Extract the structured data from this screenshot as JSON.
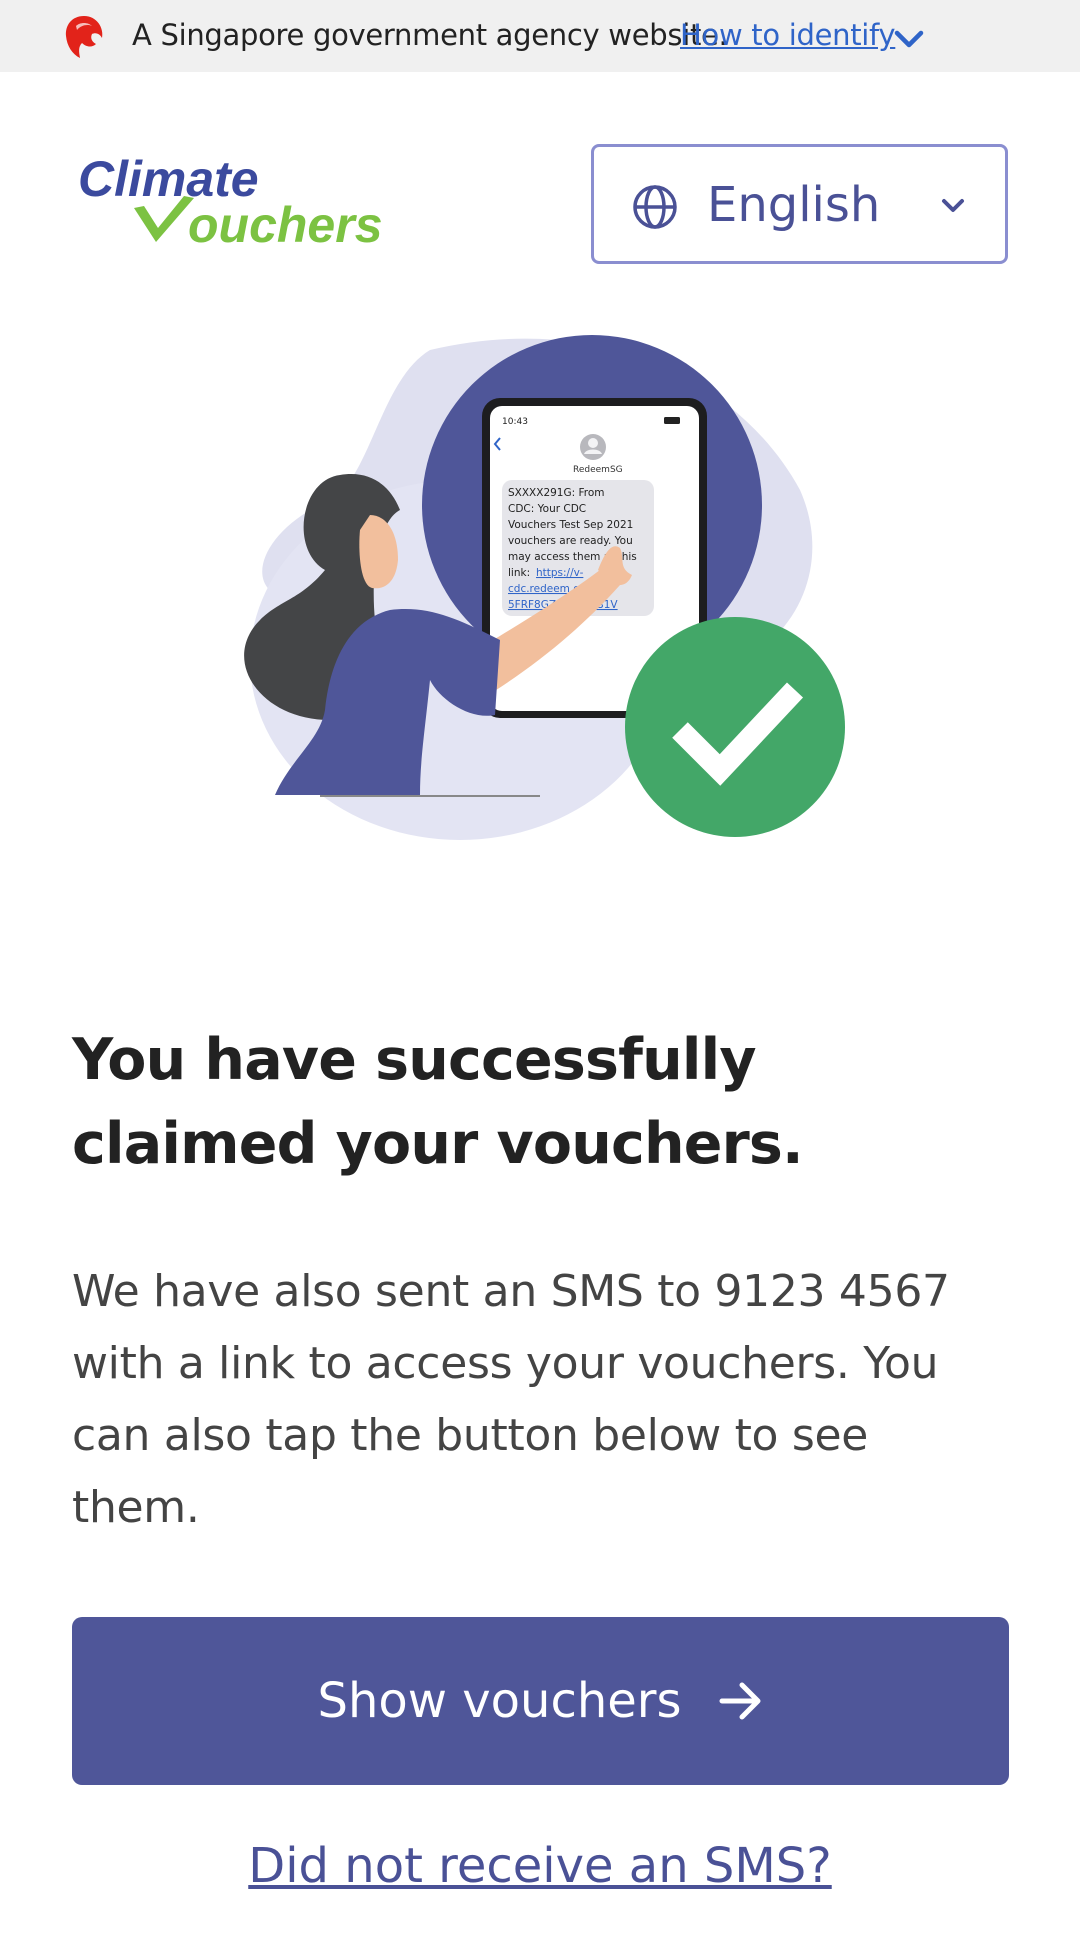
{
  "masthead": {
    "text": "A Singapore government agency website.",
    "link": "How to identify",
    "icon": "lion-head-icon"
  },
  "header": {
    "logo_line1": "Climate",
    "logo_line2": "ouchers",
    "language": {
      "selected": "English"
    }
  },
  "illustration": {
    "phone": {
      "time": "10:43",
      "sender": "RedeemSG",
      "message_lines": [
        "SXXXX291G: From",
        "CDC: Your CDC",
        "Vouchers Test Sep 2021",
        "vouchers are ready. You",
        "may access them at this",
        "link:"
      ],
      "link_lines": [
        "https://v-",
        "cdc.redeem.gov.sg/",
        "5FRF8GZHWFOHB1V"
      ]
    }
  },
  "main": {
    "title_line1": "You have successfully",
    "title_line2": "claimed your vouchers.",
    "body_lines": [
      "We have also sent an SMS to 9123 4567",
      "with a link to access your vouchers. You",
      "can also tap the button below to see",
      "them."
    ],
    "show_button": "Show vouchers",
    "sms_link": "Did not receive an SMS?"
  },
  "colors": {
    "primary": "#4f5699",
    "link_blue": "#2f64c8",
    "success_green": "#43a768",
    "logo_blue": "#3b4a9e",
    "logo_green": "#7cc242"
  }
}
